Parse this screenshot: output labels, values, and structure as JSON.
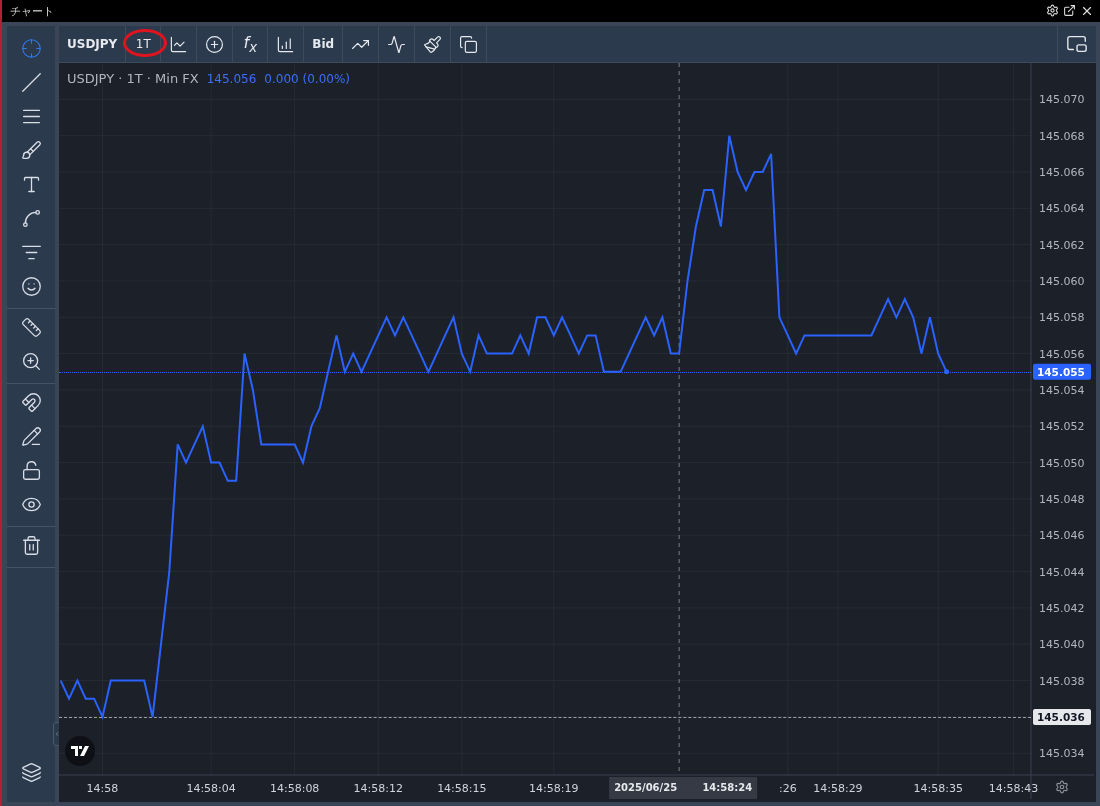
{
  "window": {
    "title": "チャート"
  },
  "toolbar": {
    "items": [
      {
        "kind": "symbol",
        "label": "USDJPY"
      },
      {
        "kind": "interval",
        "label": "1T",
        "highlighted": true
      },
      {
        "kind": "charttype"
      },
      {
        "kind": "compare"
      },
      {
        "kind": "function",
        "label": "f$_{x}$"
      },
      {
        "kind": "indicators"
      },
      {
        "kind": "text",
        "label": "Bid"
      },
      {
        "kind": "trend"
      },
      {
        "kind": "pulse"
      },
      {
        "kind": "brush"
      },
      {
        "kind": "copy"
      }
    ]
  },
  "left_toolbar": {
    "groups": [
      [
        {
          "selected": true
        },
        {
          "selected": false
        },
        {
          "selected": false
        },
        {
          "selected": false
        },
        {
          "selected": false
        },
        {
          "selected": false
        },
        {
          "selected": false
        },
        {
          "selected": false
        }
      ],
      [
        {
          "selected": false
        },
        {
          "selected": false
        }
      ],
      [
        {
          "selected": false
        },
        {
          "selected": false
        },
        {
          "selected": false
        },
        {
          "selected": false
        }
      ],
      [
        {
          "selected": false
        }
      ]
    ]
  },
  "legend": {
    "title": "USDJPY · 1T · Min FX",
    "price": "145.056",
    "change": "0.000 (0.00%)"
  },
  "crosshair": {
    "date": "2025/06/25",
    "time": "14:58:24"
  },
  "price_marks": [
    {
      "kind": "last",
      "label": "145.055"
    },
    {
      "kind": "crosshair",
      "label": "145.036"
    }
  ],
  "chart_data": {
    "type": "line",
    "grid": true,
    "categories": [
      null,
      null,
      null,
      null,
      null,
      "14:58",
      null,
      null,
      null,
      null,
      null,
      null,
      null,
      null,
      null,
      null,
      null,
      null,
      "14:58:04",
      null,
      null,
      null,
      null,
      null,
      null,
      null,
      null,
      null,
      "14:58:08",
      null,
      null,
      null,
      null,
      null,
      null,
      null,
      null,
      null,
      "14:58:12",
      null,
      null,
      null,
      null,
      null,
      null,
      null,
      null,
      null,
      "14:58:15",
      null,
      null,
      null,
      null,
      null,
      null,
      null,
      null,
      null,
      null,
      "14:58:19",
      null,
      null,
      null,
      null,
      null,
      null,
      null,
      null,
      null,
      null,
      null,
      null,
      null,
      null,
      null,
      null,
      null,
      null,
      null,
      null,
      null,
      null,
      null,
      null,
      null,
      null,
      null,
      ":26",
      null,
      null,
      null,
      null,
      null,
      "14:58:29",
      null,
      null,
      null,
      null,
      null,
      null,
      null,
      null,
      null,
      null,
      null,
      "14:58:35",
      null,
      null,
      null,
      null,
      null,
      null,
      null,
      null,
      "14:58:43",
      null,
      null
    ],
    "series": [
      {
        "color": "#2962ff",
        "values": [
          145.038,
          145.037,
          145.038,
          145.037,
          145.037,
          145.036,
          145.038,
          145.038,
          145.038,
          145.038,
          145.038,
          145.036,
          145.04,
          145.044,
          145.051,
          145.05,
          145.051,
          145.052,
          145.05,
          145.05,
          145.049,
          145.049,
          145.056,
          145.054,
          145.051,
          145.051,
          145.051,
          145.051,
          145.051,
          145.05,
          145.052,
          145.053,
          145.055,
          145.057,
          145.055,
          145.056,
          145.055,
          145.056,
          145.057,
          145.058,
          145.057,
          145.058,
          145.057,
          145.056,
          145.055,
          145.056,
          145.057,
          145.058,
          145.056,
          145.055,
          145.057,
          145.056,
          145.056,
          145.056,
          145.056,
          145.057,
          145.056,
          145.058,
          145.058,
          145.057,
          145.058,
          145.057,
          145.056,
          145.057,
          145.057,
          145.055,
          145.055,
          145.055,
          145.056,
          145.057,
          145.058,
          145.057,
          145.058,
          145.056,
          145.056,
          145.06,
          145.063,
          145.065,
          145.065,
          145.063,
          145.068,
          145.066,
          145.065,
          145.066,
          145.066,
          145.067,
          145.058,
          145.057,
          145.056,
          145.057,
          145.057,
          145.057,
          145.057,
          145.057,
          145.057,
          145.057,
          145.057,
          145.057,
          145.058,
          145.059,
          145.058,
          145.059,
          145.058,
          145.056,
          145.058,
          145.056,
          145.055,
          null,
          null,
          null,
          null,
          null,
          null,
          null,
          null,
          null,
          null
        ]
      }
    ],
    "ylim": [
      145.0328,
      145.072
    ],
    "yticks": [
      {
        "value": 145.034,
        "label": "145.034"
      },
      {
        "value": 145.036,
        "label": "145.036"
      },
      {
        "value": 145.038,
        "label": "145.038"
      },
      {
        "value": 145.04,
        "label": "145.040"
      },
      {
        "value": 145.042,
        "label": "145.042"
      },
      {
        "value": 145.044,
        "label": "145.044"
      },
      {
        "value": 145.046,
        "label": "145.046"
      },
      {
        "value": 145.048,
        "label": "145.048"
      },
      {
        "value": 145.05,
        "label": "145.050"
      },
      {
        "value": 145.052,
        "label": "145.052"
      },
      {
        "value": 145.054,
        "label": "145.054"
      },
      {
        "value": 145.056,
        "label": "145.056"
      },
      {
        "value": 145.058,
        "label": "145.058"
      },
      {
        "value": 145.06,
        "label": "145.060"
      },
      {
        "value": 145.062,
        "label": "145.062"
      },
      {
        "value": 145.064,
        "label": "145.064"
      },
      {
        "value": 145.066,
        "label": "145.066"
      },
      {
        "value": 145.068,
        "label": "145.068"
      },
      {
        "value": 145.07,
        "label": "145.070"
      }
    ]
  }
}
